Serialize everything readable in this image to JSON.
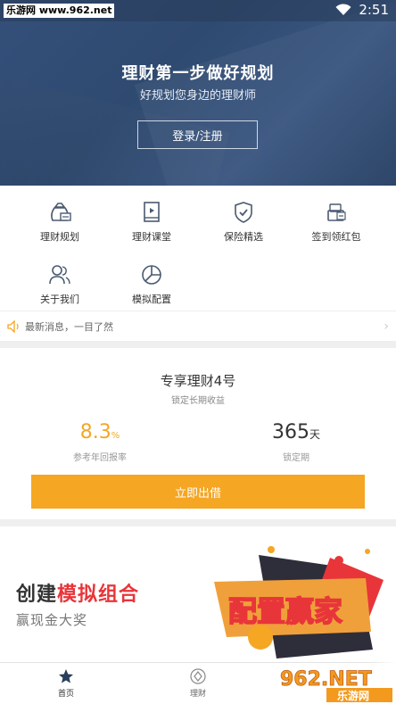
{
  "status_bar": {
    "watermark": "乐游网 www.962.net",
    "time": "2:51"
  },
  "hero": {
    "title": "理财第一步做好规划",
    "subtitle": "好规划您身边的理财师",
    "login_label": "登录/注册"
  },
  "menu": {
    "items": [
      {
        "label": "理财规划",
        "icon": "money-bag-icon"
      },
      {
        "label": "理财课堂",
        "icon": "video-book-icon"
      },
      {
        "label": "保险精选",
        "icon": "shield-check-icon"
      },
      {
        "label": "签到领红包",
        "icon": "red-envelope-icon"
      },
      {
        "label": "关于我们",
        "icon": "people-icon"
      },
      {
        "label": "模拟配置",
        "icon": "pie-chart-icon"
      }
    ]
  },
  "news": {
    "text": "最新消息，一目了然"
  },
  "product": {
    "title": "专享理财4号",
    "subtitle": "锁定长期收益",
    "rate_value": "8.3",
    "rate_unit": "%",
    "rate_label": "参考年回报率",
    "term_value": "365",
    "term_unit": "天",
    "term_label": "锁定期",
    "invest_label": "立即出借"
  },
  "banner": {
    "title_prefix": "创建",
    "title_highlight": "模拟组合",
    "subtitle": "赢现金大奖",
    "art_text": "配置赢家"
  },
  "tabbar": {
    "tabs": [
      {
        "label": "首页",
        "icon": "star-icon",
        "active": true
      },
      {
        "label": "理财",
        "icon": "diamond-icon",
        "active": false
      }
    ]
  },
  "overlay_logo": {
    "text": "962.NET",
    "subtext": "乐游网"
  },
  "colors": {
    "accent": "#f5a623",
    "hero_bg": "#34507a",
    "highlight_red": "#e8353a"
  }
}
